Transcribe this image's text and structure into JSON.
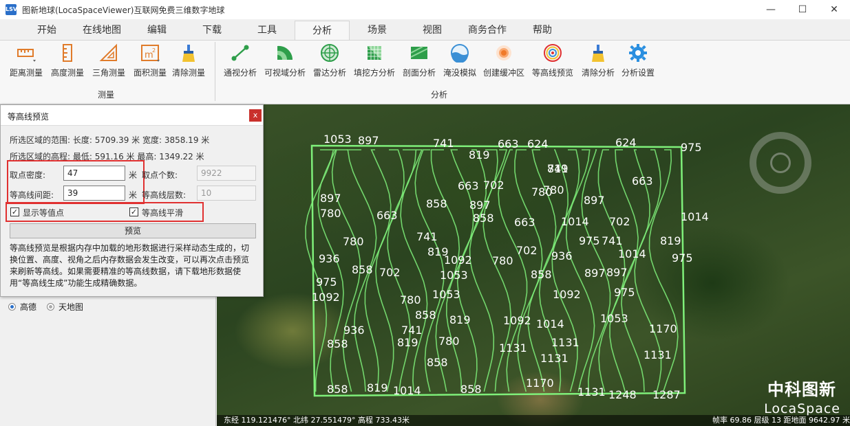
{
  "app": {
    "title": "图新地球(LocaSpaceViewer)互联网免费三维数字地球",
    "icon_text": "LSV",
    "window_controls": [
      "minimize-icon",
      "maximize-icon",
      "close-icon"
    ]
  },
  "tabs": [
    "开始",
    "在线地图",
    "编辑",
    "下载",
    "工具",
    "分析",
    "场景",
    "视图",
    "商务合作",
    "帮助"
  ],
  "active_tab": "分析",
  "ribbon": {
    "measure_group": {
      "label": "测量",
      "buttons": [
        "距离测量",
        "高度测量",
        "三角测量",
        "面积测量",
        "清除测量"
      ]
    },
    "analysis_group": {
      "label": "分析",
      "buttons": [
        "通视分析",
        "可视域分析",
        "雷达分析",
        "填挖方分析",
        "剖面分析",
        "淹没模拟",
        "创建缓冲区",
        "等高线预览",
        "清除分析",
        "分析设置"
      ]
    }
  },
  "dialog": {
    "title": "等高线预览",
    "close_label": "x",
    "range_line": "所选区域的范围:  长度:  5709.39  米  宽度:  3858.19  米",
    "elev_line": "所选区域的高程:  最低:  591.16  米  最高:  1349.22  米",
    "density_label": "取点密度:",
    "density_value": "47",
    "density_unit": "米",
    "point_count_label": "取点个数:",
    "point_count_value": "9922",
    "interval_label": "等高线间距:",
    "interval_value": "39",
    "interval_unit": "米",
    "layers_label": "等高线层数:",
    "layers_value": "10",
    "show_values_label": "显示等值点",
    "show_values_checked": true,
    "smooth_label": "等高线平滑",
    "smooth_checked": true,
    "preview_button": "预览",
    "description": "等高线预览是根据内存中加载的地形数据进行采样动态生成的，切换位置、高度、视角之后内存数据会发生改变，可以再次点击预览来刷新等高线。如果需要精准的等高线数据，请下载地形数据使用“等高线生成”功能生成精确数据。"
  },
  "left_panel": {
    "radio_options": [
      {
        "label": "高德",
        "selected": true
      },
      {
        "label": "天地图",
        "selected": false
      }
    ]
  },
  "map": {
    "contour_color": "#7ff07a",
    "labels": [
      "1053",
      "897",
      "741",
      "663",
      "624",
      "819",
      "624",
      "975",
      "819",
      "741",
      "702",
      "663",
      "780",
      "663",
      "780",
      "897",
      "897",
      "780",
      "663",
      "897",
      "858",
      "858",
      "663",
      "1014",
      "702",
      "1014",
      "780",
      "741",
      "975",
      "741",
      "819",
      "819",
      "1092",
      "780",
      "702",
      "936",
      "1014",
      "975",
      "936",
      "858",
      "702",
      "1053",
      "858",
      "897",
      "975",
      "897",
      "1092",
      "780",
      "1053",
      "1092",
      "975",
      "858",
      "819",
      "1092",
      "1014",
      "1053",
      "1170",
      "936",
      "741",
      "858",
      "819",
      "780",
      "1131",
      "1131",
      "1131",
      "858",
      "1131",
      "858",
      "819",
      "1014",
      "858",
      "1170",
      "1131",
      "1248",
      "1287"
    ],
    "status_left": "东经 119.121476°  北纬 27.551479°  高程 733.43米",
    "status_right": "帧率 69.86  层级 13  距地面 9642.97 米",
    "brand_cn": "中科图新",
    "brand_en": "LocaSpace"
  }
}
